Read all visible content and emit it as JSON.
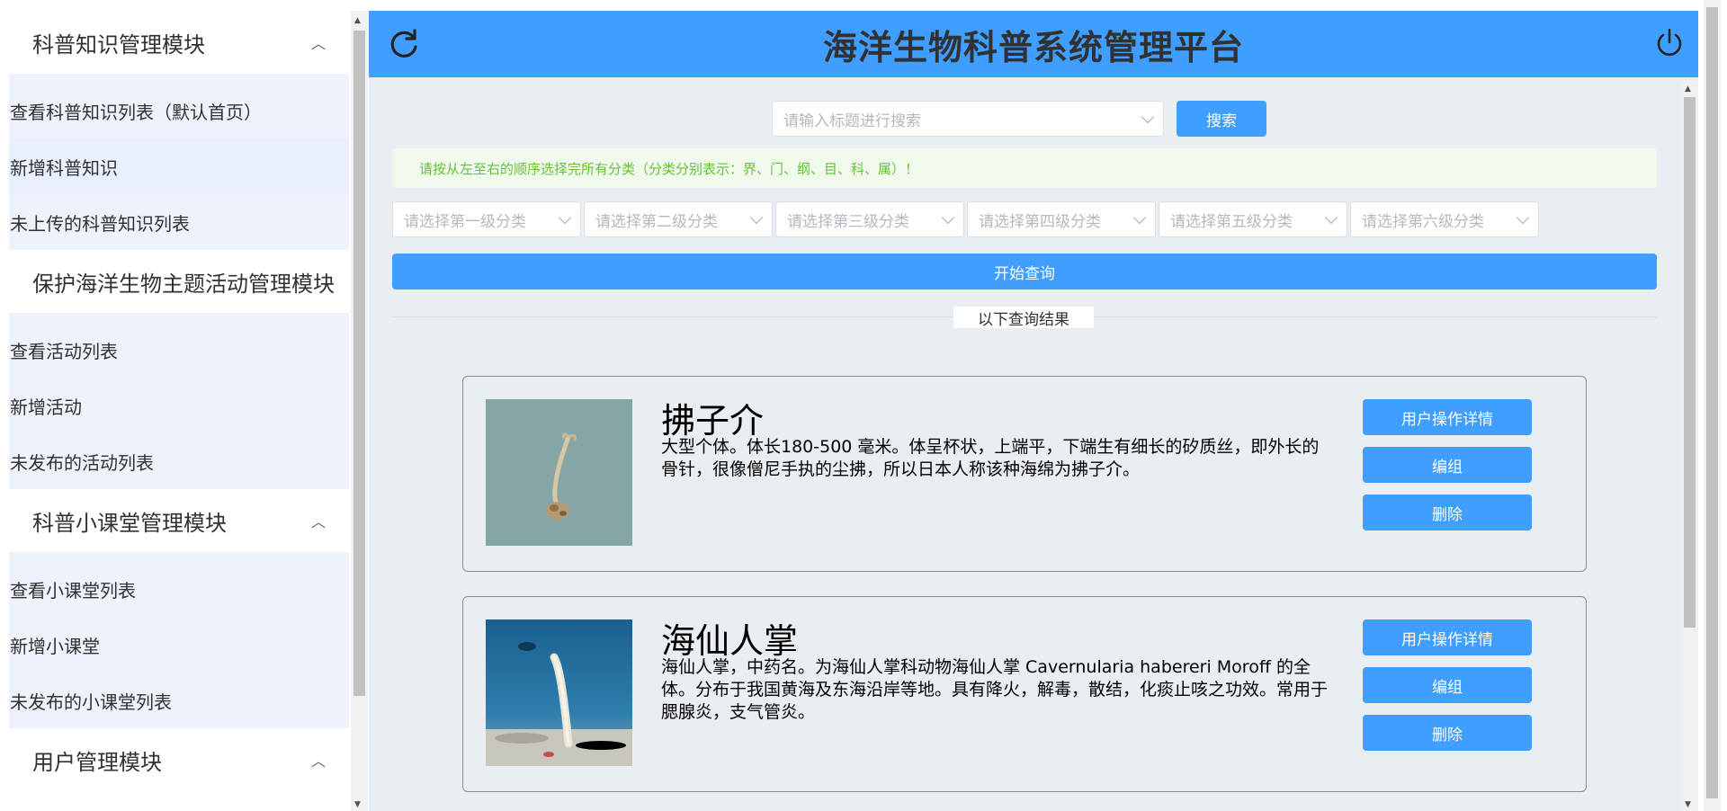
{
  "app": {
    "title": "海洋生物科普系统管理平台"
  },
  "sidebar": {
    "groups": [
      {
        "title": "科普知识管理模块",
        "chevron": "chevron-up-icon",
        "items": [
          "查看科普知识列表（默认首页）",
          "新增科普知识",
          "未上传的科普知识列表"
        ]
      },
      {
        "title": "保护海洋生物主题活动管理模块",
        "items": [
          "查看活动列表",
          "新增活动",
          "未发布的活动列表"
        ]
      },
      {
        "title": "科普小课堂管理模块",
        "chevron": "chevron-up-icon",
        "items": [
          "查看小课堂列表",
          "新增小课堂",
          "未发布的小课堂列表"
        ]
      },
      {
        "title": "用户管理模块",
        "chevron": "chevron-up-icon",
        "items": []
      }
    ],
    "active_item": "新增科普知识"
  },
  "search": {
    "placeholder": "请输入标题进行搜索",
    "button_label": "搜索"
  },
  "notice": "请按从左至右的顺序选择完所有分类（分类分别表示：界、门、纲、目、科、属）！",
  "categories": [
    "请选择第一级分类",
    "请选择第二级分类",
    "请选择第三级分类",
    "请选择第四级分类",
    "请选择第五级分类",
    "请选择第六级分类"
  ],
  "query_button_label": "开始查询",
  "results_divider_label": "以下查询结果",
  "results": [
    {
      "name": "拂子介",
      "description": "大型个体。体长180-500 毫米。体呈杯状，上端平，下端生有细长的矽质丝，即外长的骨针，很像僧尼手执的尘拂，所以日本人称该种海绵为拂子介。",
      "actions": [
        "用户操作详情",
        "编组",
        "删除"
      ]
    },
    {
      "name": "海仙人掌",
      "description": "海仙人掌，中药名。为海仙人掌科动物海仙人掌 Cavernularia habereri Moroff 的全体。分布于我国黄海及东海沿岸等地。具有降火，解毒，散结，化痰止咳之功效。常用于腮腺炎，支气管炎。",
      "actions": [
        "用户操作详情",
        "编组",
        "删除"
      ]
    }
  ],
  "colors": {
    "primary": "#409eff",
    "notice_bg": "#f0f9eb",
    "notice_text": "#67c23a",
    "main_bg": "#e9eef3"
  },
  "icons": {
    "refresh": "refresh-icon",
    "power": "power-icon",
    "dropdown": "chevron-down-icon"
  }
}
